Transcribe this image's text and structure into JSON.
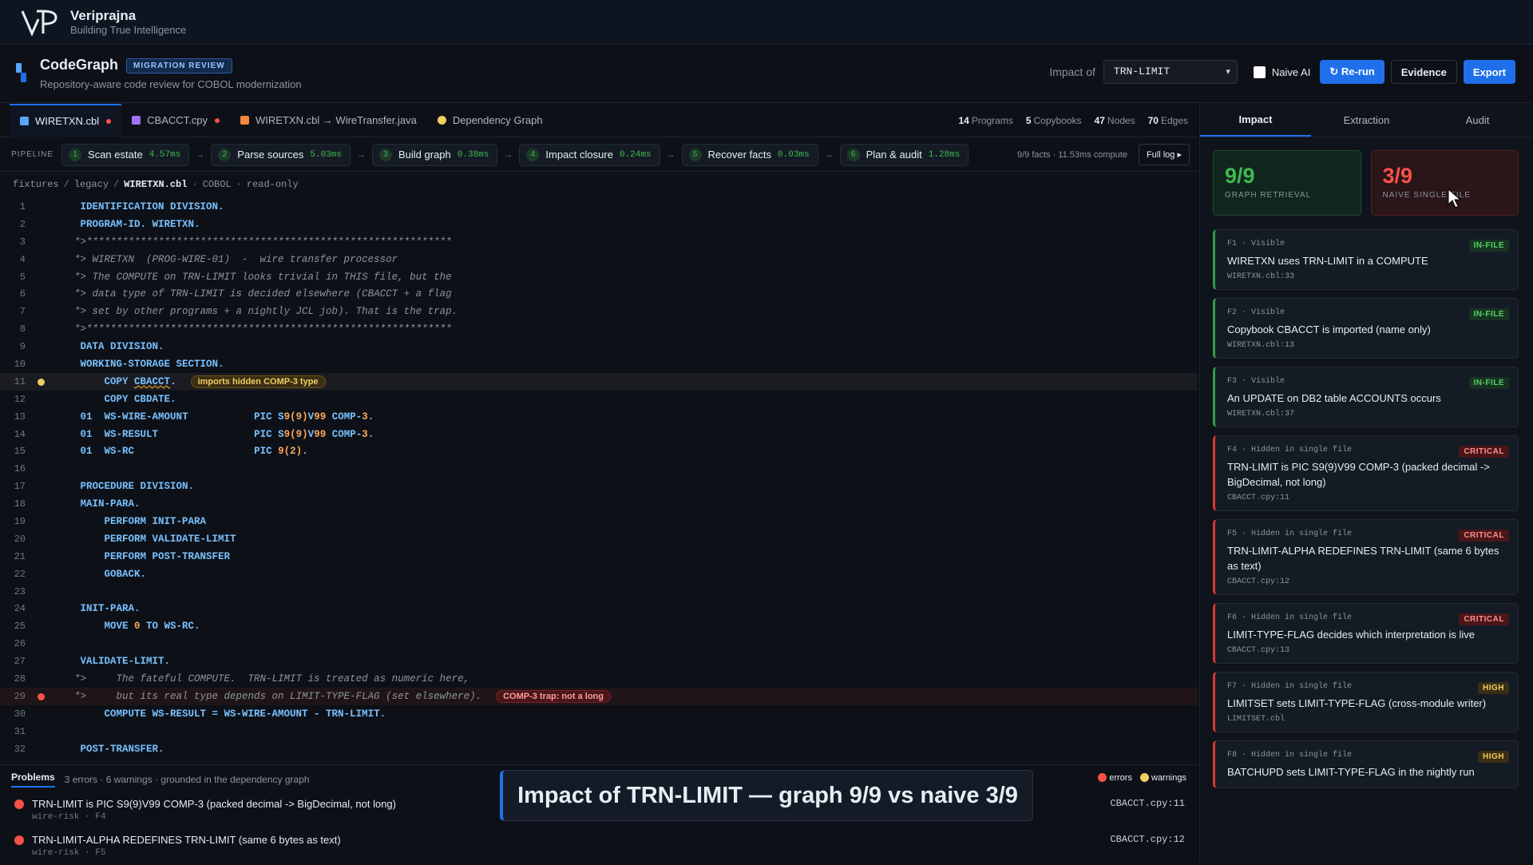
{
  "brand": {
    "name": "Veriprajna",
    "tagline": "Building True Intelligence"
  },
  "header": {
    "title": "CodeGraph",
    "badge": "MIGRATION REVIEW",
    "subtitle": "Repository-aware code review for COBOL modernization",
    "impact_label": "Impact of",
    "impact_value": "TRN-LIMIT",
    "naive_label": "Naive AI",
    "naive_checked": false,
    "rerun": "↻ Re-run",
    "evidence": "Evidence",
    "export": "Export"
  },
  "tabs": [
    {
      "label": "WIRETXN.cbl",
      "color": "#58a6ff",
      "dirty": true,
      "active": true
    },
    {
      "label": "CBACCT.cpy",
      "color": "#a371f7",
      "dirty": true,
      "active": false
    },
    {
      "label": "WIRETXN.cbl → WireTransfer.java",
      "color": "#f0883e",
      "dirty": false,
      "active": false
    },
    {
      "label": "Dependency Graph",
      "color": "#f2cc60",
      "dirty": false,
      "active": false
    }
  ],
  "stats": [
    {
      "value": "14",
      "label": "Programs"
    },
    {
      "value": "5",
      "label": "Copybooks"
    },
    {
      "value": "47",
      "label": "Nodes"
    },
    {
      "value": "70",
      "label": "Edges"
    }
  ],
  "pipeline": {
    "label": "PIPELINE",
    "steps": [
      {
        "n": "1",
        "label": "Scan estate",
        "time": "4.57ms"
      },
      {
        "n": "2",
        "label": "Parse sources",
        "time": "5.03ms"
      },
      {
        "n": "3",
        "label": "Build graph",
        "time": "0.38ms"
      },
      {
        "n": "4",
        "label": "Impact closure",
        "time": "0.24ms"
      },
      {
        "n": "5",
        "label": "Recover facts",
        "time": "0.03ms"
      },
      {
        "n": "6",
        "label": "Plan & audit",
        "time": "1.28ms"
      }
    ],
    "summary": "9/9 facts · 11.53ms compute",
    "full_log": "Full log ▸"
  },
  "breadcrumb": {
    "parts": [
      "fixtures",
      "legacy",
      "WIRETXN.cbl"
    ],
    "lang": "COBOL",
    "mode": "read-only"
  },
  "code": [
    {
      "n": "1",
      "text": "       IDENTIFICATION DIVISION.",
      "type": "kw"
    },
    {
      "n": "2",
      "text": "       PROGRAM-ID. WIRETXN.",
      "type": "kw"
    },
    {
      "n": "3",
      "text": "      *>*************************************************************",
      "type": "cm"
    },
    {
      "n": "4",
      "text": "      *> WIRETXN  (PROG-WIRE-01)  -  wire transfer processor",
      "type": "cm"
    },
    {
      "n": "5",
      "text": "      *> The COMPUTE on TRN-LIMIT looks trivial in THIS file, but the",
      "type": "cm"
    },
    {
      "n": "6",
      "text": "      *> data type of TRN-LIMIT is decided elsewhere (CBACCT + a flag",
      "type": "cm"
    },
    {
      "n": "7",
      "text": "      *> set by other programs + a nightly JCL job). That is the trap.",
      "type": "cm"
    },
    {
      "n": "8",
      "text": "      *>*************************************************************",
      "type": "cm"
    },
    {
      "n": "9",
      "text": "       DATA DIVISION.",
      "type": "kw"
    },
    {
      "n": "10",
      "text": "       WORKING-STORAGE SECTION.",
      "type": "kw"
    },
    {
      "n": "11",
      "text": "           COPY CBACCT.",
      "type": "copy",
      "marker": "warn",
      "pill": "imports hidden COMP-3 type"
    },
    {
      "n": "12",
      "text": "           COPY CBDATE.",
      "type": "kw"
    },
    {
      "n": "13",
      "text": "       01  WS-WIRE-AMOUNT           PIC S9(9)V99 COMP-3.",
      "type": "pic"
    },
    {
      "n": "14",
      "text": "       01  WS-RESULT                PIC S9(9)V99 COMP-3.",
      "type": "pic"
    },
    {
      "n": "15",
      "text": "       01  WS-RC                    PIC 9(2).",
      "type": "pic"
    },
    {
      "n": "16",
      "text": "",
      "type": "kw"
    },
    {
      "n": "17",
      "text": "       PROCEDURE DIVISION.",
      "type": "kw"
    },
    {
      "n": "18",
      "text": "       MAIN-PARA.",
      "type": "kw"
    },
    {
      "n": "19",
      "text": "           PERFORM INIT-PARA",
      "type": "kw"
    },
    {
      "n": "20",
      "text": "           PERFORM VALIDATE-LIMIT",
      "type": "kw"
    },
    {
      "n": "21",
      "text": "           PERFORM POST-TRANSFER",
      "type": "kw"
    },
    {
      "n": "22",
      "text": "           GOBACK.",
      "type": "kw"
    },
    {
      "n": "23",
      "text": "",
      "type": "kw"
    },
    {
      "n": "24",
      "text": "       INIT-PARA.",
      "type": "kw"
    },
    {
      "n": "25",
      "text": "           MOVE 0 TO WS-RC.",
      "type": "kw"
    },
    {
      "n": "26",
      "text": "",
      "type": "kw"
    },
    {
      "n": "27",
      "text": "       VALIDATE-LIMIT.",
      "type": "kw"
    },
    {
      "n": "28",
      "text": "      *>     The fateful COMPUTE.  TRN-LIMIT is treated as numeric here,",
      "type": "cm"
    },
    {
      "n": "29",
      "text": "      *>     but its real type depends on LIMIT-TYPE-FLAG (set elsewhere).",
      "type": "cm",
      "marker": "err",
      "pill": "COMP-3 trap: not a long"
    },
    {
      "n": "30",
      "text": "           COMPUTE WS-RESULT = WS-WIRE-AMOUNT - TRN-LIMIT.",
      "type": "kw"
    },
    {
      "n": "31",
      "text": "",
      "type": "kw"
    },
    {
      "n": "32",
      "text": "       POST-TRANSFER.",
      "type": "kw"
    }
  ],
  "problems": {
    "title": "Problems",
    "summary": "3 errors · 6 warnings · grounded in the dependency graph",
    "legend_errors": "errors",
    "legend_warnings": "warnings",
    "items": [
      {
        "text": "TRN-LIMIT is PIC S9(9)V99 COMP-3 (packed decimal -> BigDecimal, not long)",
        "meta": "wire-risk · F4",
        "loc": "CBACCT.cpy:11"
      },
      {
        "text": "TRN-LIMIT-ALPHA REDEFINES TRN-LIMIT (same 6 bytes as text)",
        "meta": "wire-risk · F5",
        "loc": "CBACCT.cpy:12"
      }
    ]
  },
  "caption": "Impact of TRN-LIMIT — graph 9/9 vs naive 3/9",
  "panel": {
    "tabs": [
      "Impact",
      "Extraction",
      "Audit"
    ],
    "graph_score": "9/9",
    "graph_label": "GRAPH RETRIEVAL",
    "naive_score": "3/9",
    "naive_label": "NAIVE SINGLE FILE",
    "facts": [
      {
        "head": "F1 · Visible",
        "tag": "IN-FILE",
        "kind": "infile",
        "title": "WIRETXN uses TRN-LIMIT in a COMPUTE",
        "loc": "WIRETXN.cbl:33"
      },
      {
        "head": "F2 · Visible",
        "tag": "IN-FILE",
        "kind": "infile",
        "title": "Copybook CBACCT is imported (name only)",
        "loc": "WIRETXN.cbl:13"
      },
      {
        "head": "F3 · Visible",
        "tag": "IN-FILE",
        "kind": "infile",
        "title": "An UPDATE on DB2 table ACCOUNTS occurs",
        "loc": "WIRETXN.cbl:37"
      },
      {
        "head": "F4 · Hidden in single file",
        "tag": "CRITICAL",
        "kind": "crit",
        "title": "TRN-LIMIT is PIC S9(9)V99 COMP-3 (packed decimal -> BigDecimal, not long)",
        "loc": "CBACCT.cpy:11"
      },
      {
        "head": "F5 · Hidden in single file",
        "tag": "CRITICAL",
        "kind": "crit",
        "title": "TRN-LIMIT-ALPHA REDEFINES TRN-LIMIT (same 6 bytes as text)",
        "loc": "CBACCT.cpy:12"
      },
      {
        "head": "F6 · Hidden in single file",
        "tag": "CRITICAL",
        "kind": "crit",
        "title": "LIMIT-TYPE-FLAG decides which interpretation is live",
        "loc": "CBACCT.cpy:13"
      },
      {
        "head": "F7 · Hidden in single file",
        "tag": "HIGH",
        "kind": "high",
        "title": "LIMITSET sets LIMIT-TYPE-FLAG (cross-module writer)",
        "loc": "LIMITSET.cbl"
      },
      {
        "head": "F8 · Hidden in single file",
        "tag": "HIGH",
        "kind": "high",
        "title": "BATCHUPD sets LIMIT-TYPE-FLAG in the nightly run",
        "loc": ""
      }
    ]
  }
}
